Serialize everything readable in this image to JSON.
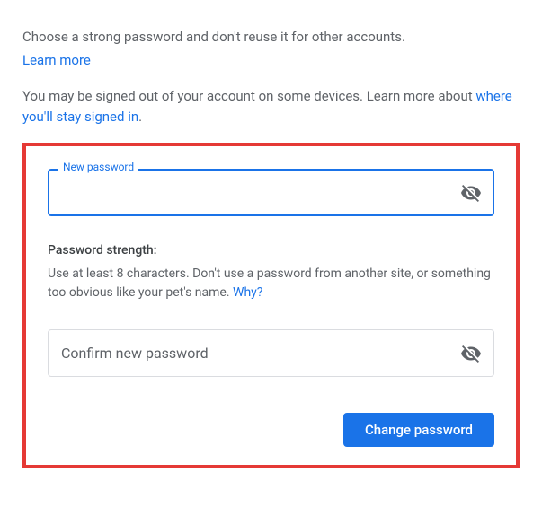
{
  "intro": {
    "line1": "Choose a strong password and don't reuse it for other accounts.",
    "learn_more": "Learn more",
    "line2a": "You may be signed out of your account on some devices. Learn more about ",
    "line2_link": "where you'll stay signed in",
    "line2b": "."
  },
  "new_password": {
    "label": "New password",
    "value": ""
  },
  "strength": {
    "title": "Password strength:",
    "desc": "Use at least 8 characters. Don't use a password from another site, or something too obvious like your pet's name. ",
    "why": "Why?"
  },
  "confirm": {
    "placeholder": "Confirm new password",
    "value": ""
  },
  "button": {
    "change": "Change password"
  }
}
